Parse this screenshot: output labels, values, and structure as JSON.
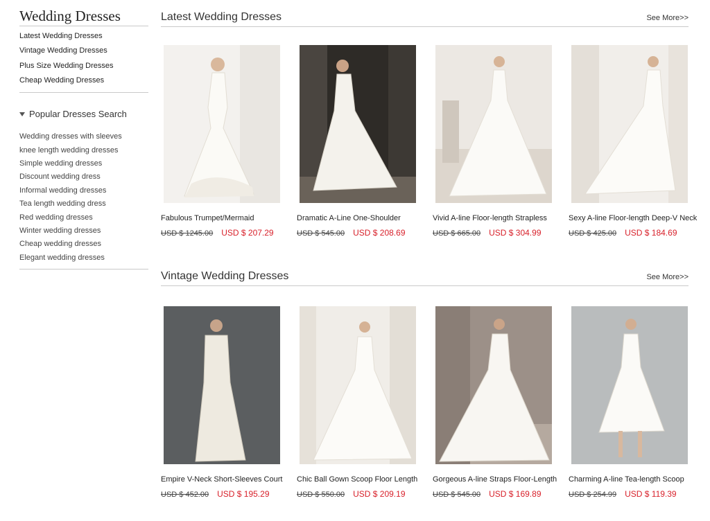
{
  "sidebar": {
    "title": "Wedding Dresses",
    "categories": [
      "Latest Wedding Dresses",
      "Vintage Wedding Dresses",
      "Plus Size Wedding Dresses",
      "Cheap Wedding Dresses"
    ],
    "popular_title": "Popular Dresses Search",
    "popular": [
      "Wedding dresses with sleeves",
      "knee length wedding dresses",
      "Simple wedding dresses",
      "Discount wedding dress",
      "Informal wedding dresses",
      "Tea length wedding dress",
      "Red wedding dresses",
      "Winter wedding dresses",
      "Cheap wedding dresses",
      "Elegant wedding dresses"
    ]
  },
  "sections": [
    {
      "title": "Latest Wedding Dresses",
      "see_more": "See More>>",
      "products": [
        {
          "name": "Fabulous Trumpet/Mermaid",
          "old_price": "USD $ 1245.00",
          "price": "USD $ 207.29"
        },
        {
          "name": "Dramatic A-Line One-Shoulder",
          "old_price": "USD $ 545.00",
          "price": "USD $ 208.69"
        },
        {
          "name": "Vivid A-line Floor-length Strapless",
          "old_price": "USD $ 665.00",
          "price": "USD $ 304.99"
        },
        {
          "name": "Sexy A-line Floor-length Deep-V Neck",
          "old_price": "USD $ 425.00",
          "price": "USD $ 184.69"
        }
      ]
    },
    {
      "title": "Vintage Wedding Dresses",
      "see_more": "See More>>",
      "products": [
        {
          "name": "Empire V-Neck Short-Sleeves Court",
          "old_price": "USD $ 452.00",
          "price": "USD $ 195.29"
        },
        {
          "name": "Chic Ball Gown Scoop Floor Length",
          "old_price": "USD $ 550.00",
          "price": "USD $ 209.19"
        },
        {
          "name": "Gorgeous A-line Straps Floor-Length",
          "old_price": "USD $ 545.00",
          "price": "USD $ 169.89"
        },
        {
          "name": "Charming A-line Tea-length Scoop",
          "old_price": "USD $ 254.99",
          "price": "USD $ 119.39"
        }
      ]
    }
  ],
  "colors": {
    "sale_price": "#d8202a",
    "divider": "#c9c9c9"
  },
  "icons": {
    "popular_toggle": "triangle-down-icon"
  }
}
